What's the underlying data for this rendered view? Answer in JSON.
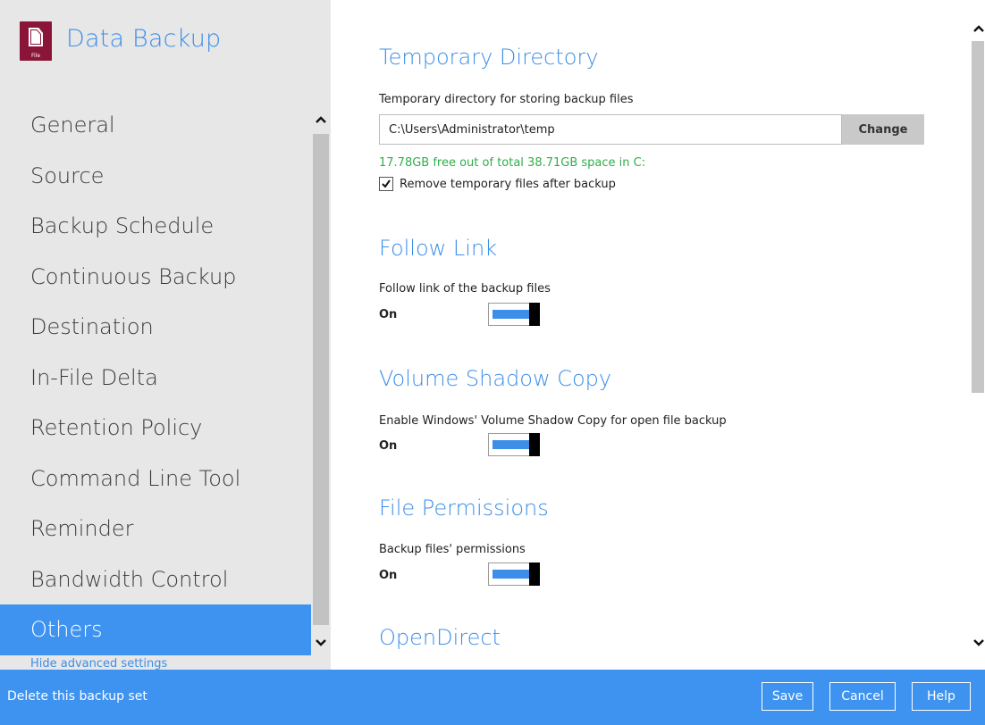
{
  "app": {
    "title": "Data Backup",
    "icon": "file-icon",
    "icon_caption": "File",
    "accent_color": "#3d93ef",
    "brand_color": "#8b1538"
  },
  "sidebar": {
    "items": [
      {
        "label": "General",
        "active": false
      },
      {
        "label": "Source",
        "active": false
      },
      {
        "label": "Backup Schedule",
        "active": false
      },
      {
        "label": "Continuous Backup",
        "active": false
      },
      {
        "label": "Destination",
        "active": false
      },
      {
        "label": "In-File Delta",
        "active": false
      },
      {
        "label": "Retention Policy",
        "active": false
      },
      {
        "label": "Command Line Tool",
        "active": false
      },
      {
        "label": "Reminder",
        "active": false
      },
      {
        "label": "Bandwidth Control",
        "active": false
      },
      {
        "label": "Others",
        "active": true
      }
    ],
    "hide_advanced_label": "Hide advanced settings"
  },
  "main": {
    "temporary_directory": {
      "title": "Temporary Directory",
      "description": "Temporary directory for storing backup files",
      "path_value": "C:\\Users\\Administrator\\temp",
      "change_label": "Change",
      "free_space_text": "17.78GB free out of total 38.71GB space in C:",
      "remove_temp_label": "Remove temporary files after backup",
      "remove_temp_checked": true
    },
    "follow_link": {
      "title": "Follow Link",
      "description": "Follow link of the backup files",
      "state_label": "On",
      "enabled": true
    },
    "volume_shadow_copy": {
      "title": "Volume Shadow Copy",
      "description": "Enable Windows' Volume Shadow Copy for open file backup",
      "state_label": "On",
      "enabled": true
    },
    "file_permissions": {
      "title": "File Permissions",
      "description": "Backup files' permissions",
      "state_label": "On",
      "enabled": true
    },
    "open_direct": {
      "title": "OpenDirect"
    }
  },
  "footer": {
    "delete_label": "Delete this backup set",
    "save_label": "Save",
    "cancel_label": "Cancel",
    "help_label": "Help"
  }
}
